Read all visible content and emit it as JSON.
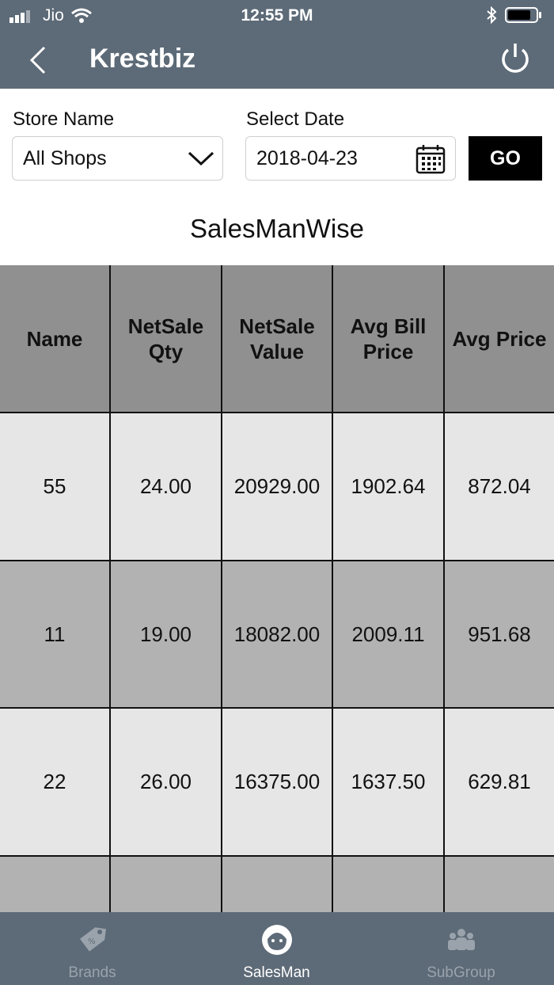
{
  "status_bar": {
    "carrier": "Jio",
    "time": "12:55 PM"
  },
  "header": {
    "title": "Krestbiz"
  },
  "filters": {
    "store_label": "Store Name",
    "store_value": "All Shops",
    "date_label": "Select Date",
    "date_value": "2018-04-23",
    "go_label": "GO"
  },
  "section_title": "SalesManWise",
  "table": {
    "headers": [
      "Name",
      "NetSale Qty",
      "NetSale Value",
      "Avg Bill Price",
      "Avg Price"
    ],
    "rows": [
      [
        "55",
        "24.00",
        "20929.00",
        "1902.64",
        "872.04"
      ],
      [
        "11",
        "19.00",
        "18082.00",
        "2009.11",
        "951.68"
      ],
      [
        "22",
        "26.00",
        "16375.00",
        "1637.50",
        "629.81"
      ]
    ]
  },
  "tabs": [
    {
      "label": "Brands",
      "icon": "brands-tag-icon"
    },
    {
      "label": "SalesMan",
      "icon": "salesman-face-icon"
    },
    {
      "label": "SubGroup",
      "icon": "subgroup-people-icon"
    }
  ],
  "colors": {
    "bar": "#5d6a77",
    "header_cell": "#909090",
    "row_light": "#e6e6e6",
    "row_dark": "#b2b2b2"
  }
}
